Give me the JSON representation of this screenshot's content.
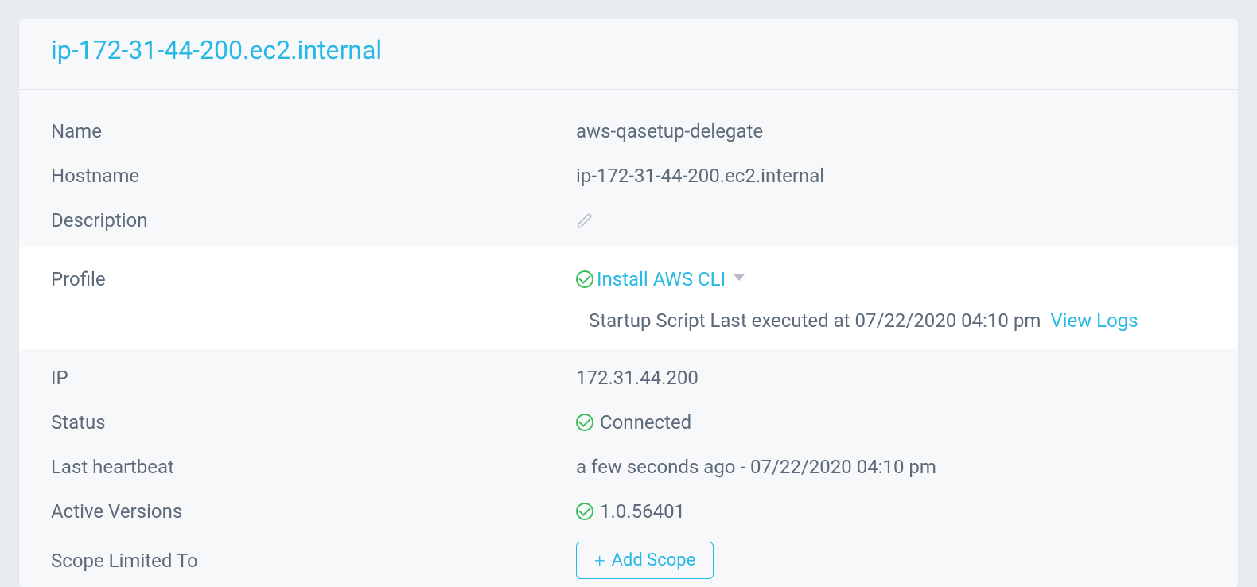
{
  "header": {
    "title": "ip-172-31-44-200.ec2.internal"
  },
  "fields": {
    "name": {
      "label": "Name",
      "value": "aws-qasetup-delegate"
    },
    "hostname": {
      "label": "Hostname",
      "value": "ip-172-31-44-200.ec2.internal"
    },
    "description": {
      "label": "Description",
      "value": ""
    },
    "profile": {
      "label": "Profile",
      "install_link": "Install AWS CLI",
      "sub_text": "Startup Script Last executed at 07/22/2020 04:10 pm",
      "view_logs": "View Logs"
    },
    "ip": {
      "label": "IP",
      "value": "172.31.44.200"
    },
    "status": {
      "label": "Status",
      "value": "Connected"
    },
    "heartbeat": {
      "label": "Last heartbeat",
      "value": "a few seconds ago - 07/22/2020 04:10 pm"
    },
    "versions": {
      "label": "Active Versions",
      "value": "1.0.56401"
    },
    "scope": {
      "label": "Scope Limited To",
      "button": "Add Scope"
    }
  }
}
